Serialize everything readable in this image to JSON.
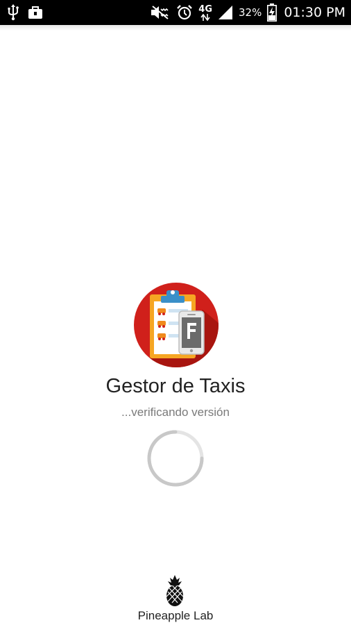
{
  "status_bar": {
    "network_type": "4G",
    "battery_percent": "32%",
    "time": "01:30 PM",
    "icons": [
      "usb-icon",
      "briefcase-notification-icon",
      "mute-icon",
      "alarm-icon",
      "network-arrows-icon",
      "signal-icon",
      "battery-charging-icon"
    ]
  },
  "splash": {
    "app_title": "Gestor de Taxis",
    "status_text": "...verificando versión",
    "logo": "taxi-clipboard-phone-logo",
    "loading_indicator": "circular-spinner"
  },
  "footer": {
    "brand": "Pineapple Lab",
    "logo": "pineapple-icon"
  },
  "colors": {
    "logo_red": "#d0201b",
    "clipboard_orange": "#f6a623",
    "clip_blue": "#3a8fc8",
    "spinner_gray": "#c8c8c8",
    "text_dark": "#222222",
    "text_gray": "#7a7a7a"
  }
}
